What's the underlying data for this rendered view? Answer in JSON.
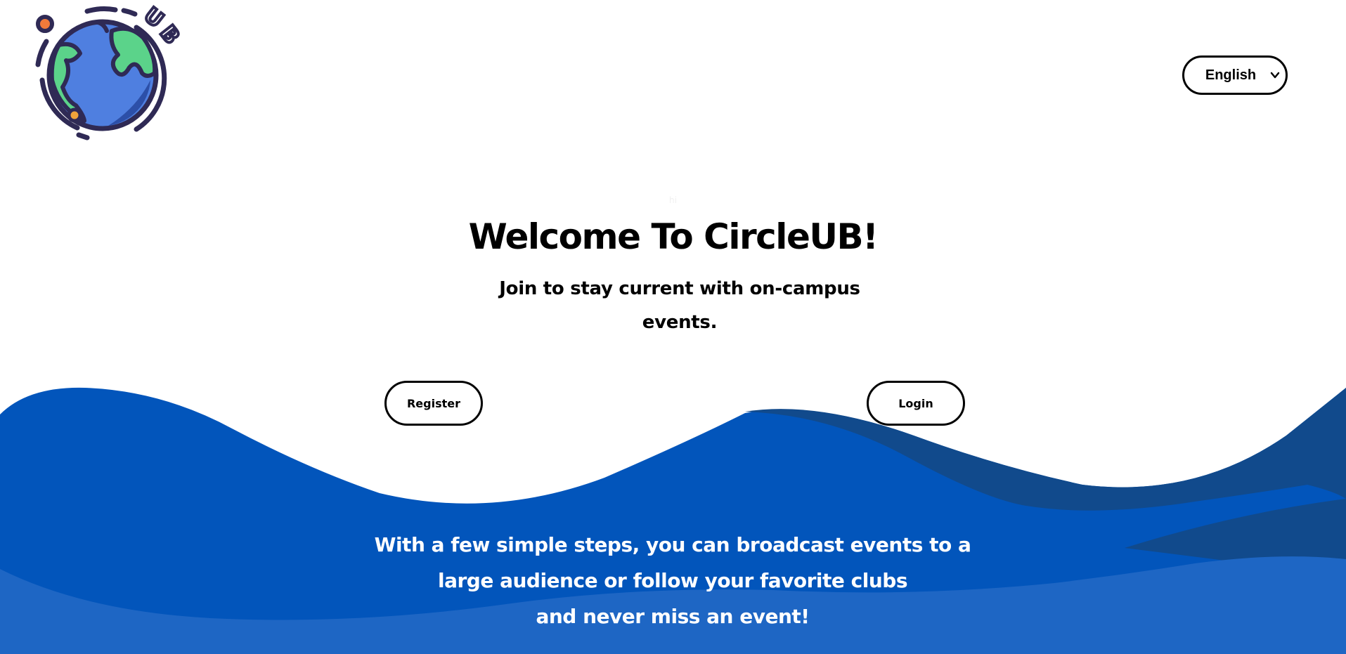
{
  "header": {
    "logo": {
      "icon": "globe-logo-icon",
      "text": "UB"
    },
    "language_select": {
      "selected": "English"
    }
  },
  "hero": {
    "small_text": "hi",
    "title": "Welcome To CircleUB!",
    "subtitle": "Join to stay current with on-campus events.",
    "register_label": "Register",
    "login_label": "Login"
  },
  "footer": {
    "tagline_lines": [
      "With a few simple steps, you can broadcast events to a",
      "large audience or follow your favorite clubs",
      "and never miss an event!"
    ]
  },
  "colors": {
    "wave_primary": "#0255BB",
    "wave_dark": "#114A8C",
    "wave_light": "#1E66C4",
    "globe_blue": "#4F7FE0",
    "globe_green": "#5BD38A",
    "logo_outline": "#2F2A55",
    "logo_orange": "#F07A3A"
  }
}
